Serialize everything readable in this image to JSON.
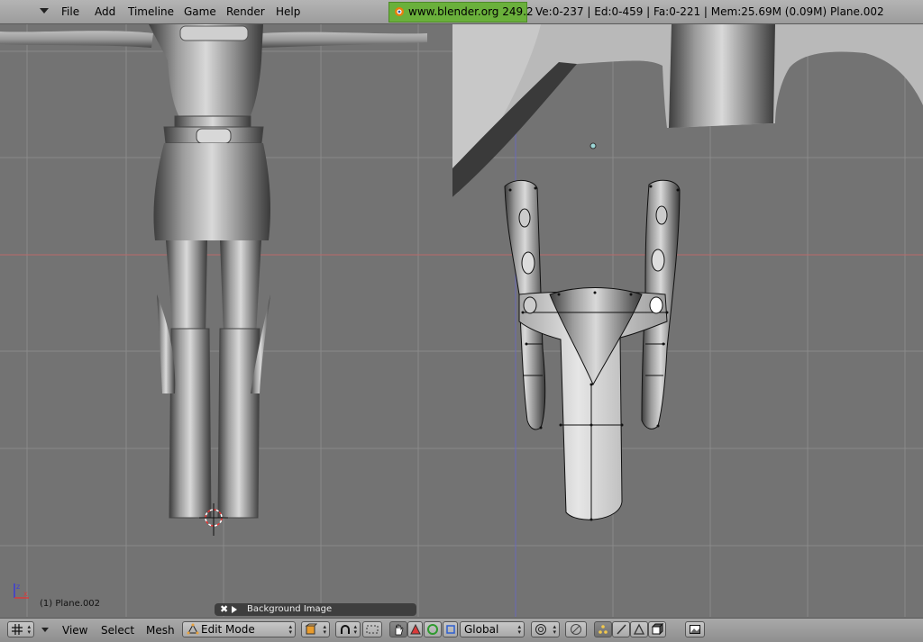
{
  "menubar": {
    "items": [
      "File",
      "Add",
      "Timeline",
      "Game",
      "Render",
      "Help"
    ],
    "website": "www.blender.org 249.2",
    "stats": "Ve:0-237 | Ed:0-459 | Fa:0-221 | Mem:25.69M (0.09M) Plane.002"
  },
  "viewport": {
    "object_label": "(1) Plane.002",
    "background_image_panel": "Background Image"
  },
  "header": {
    "menus": [
      "View",
      "Select",
      "Mesh"
    ],
    "mode": "Edit Mode",
    "orientation": "Global",
    "icons": {
      "editor_type": "grid-icon",
      "object_mode": "mesh-mode-icon",
      "draw_type": "shading-icon",
      "pivot": "pivot-icon",
      "hand": "hand-icon",
      "manipulator_translate": "triangle-icon",
      "manipulator_rotate": "ring-icon",
      "manipulator_scale": "square-icon",
      "proportional": "proportional-icon",
      "snap": "snap-icon",
      "vertex_select": "vertex-select-icon",
      "edge_select": "edge-select-icon",
      "face_select": "face-select-icon",
      "occlude": "cube-icon",
      "render_preview": "picture-icon"
    }
  },
  "colors": {
    "grid": "#898989",
    "x_axis": "#b86a6a",
    "y_axis": "#6a6ab8",
    "badge": "#6ab03b"
  }
}
